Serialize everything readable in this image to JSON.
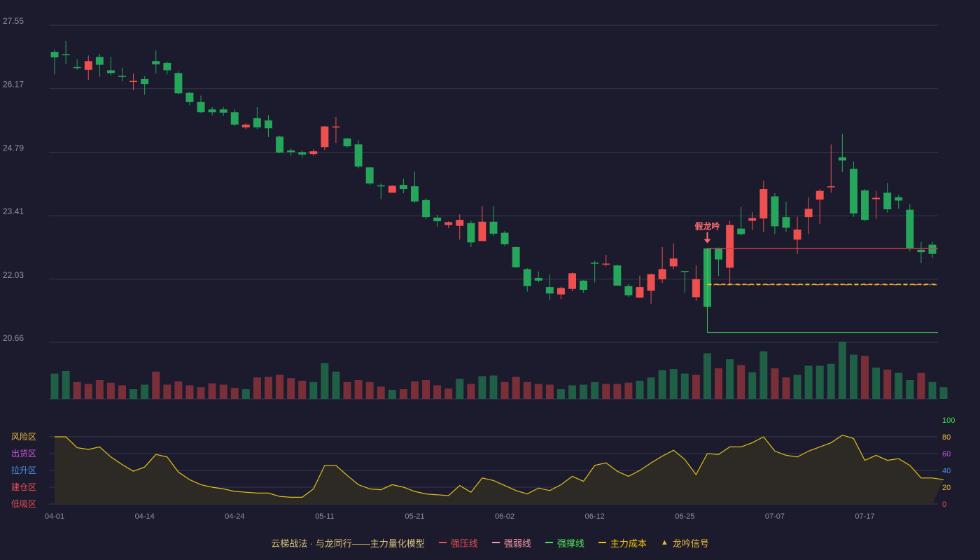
{
  "colors": {
    "background": "#1b1b2d",
    "up": "#ef4f4f",
    "down": "#26a65b",
    "up_volume": "#7a2f38",
    "down_volume": "#1f5f45",
    "strong_pressure": "#d03a45",
    "strong_weak": "#ff8fa0",
    "support": "#3ec74a",
    "main_cost": "#f5c400",
    "indicator_line": "#e2c215",
    "indicator_fill": "#2e2b25",
    "signal": "#ff6b6b",
    "grid": "#33374a",
    "axis_text": "#8a8f9e"
  },
  "legend": {
    "title": "云梯战法 · 与龙同行——主力量化模型",
    "items": [
      {
        "label": "强压线",
        "color": "#ef4f4f",
        "style": "solid"
      },
      {
        "label": "强弱线",
        "color": "#ff9aa8",
        "style": "dash"
      },
      {
        "label": "强撑线",
        "color": "#4fe35a",
        "style": "solid"
      },
      {
        "label": "主力成本",
        "color": "#f5c400",
        "style": "dash"
      },
      {
        "label": "龙吟信号",
        "color": "#f0b83a",
        "style": "triangle",
        "icon": "▲"
      }
    ]
  },
  "chart_data": {
    "type": "candlestick",
    "x_ticks": [
      "04-01",
      "04-14",
      "04-24",
      "05-11",
      "05-21",
      "06-02",
      "06-12",
      "06-25",
      "07-07",
      "07-17"
    ],
    "x_tick_index": [
      0,
      8,
      16,
      24,
      32,
      40,
      48,
      56,
      64,
      72
    ],
    "ylim": [
      20.66,
      27.55
    ],
    "y_ticks": [
      "27.55",
      "26.17",
      "24.79",
      "23.41",
      "22.03",
      "20.66"
    ],
    "candles": [
      [
        26.97,
        26.85,
        27.02,
        26.48
      ],
      [
        26.92,
        26.9,
        27.21,
        26.71
      ],
      [
        26.64,
        26.63,
        26.81,
        26.58
      ],
      [
        26.58,
        26.77,
        26.89,
        26.36
      ],
      [
        26.86,
        26.69,
        26.93,
        26.43
      ],
      [
        26.57,
        26.51,
        26.86,
        26.47
      ],
      [
        26.45,
        26.43,
        26.63,
        26.33
      ],
      [
        26.34,
        26.34,
        26.5,
        26.14
      ],
      [
        26.38,
        26.27,
        26.44,
        26.04
      ],
      [
        26.77,
        26.7,
        27.0,
        26.5
      ],
      [
        26.73,
        26.57,
        26.76,
        26.48
      ],
      [
        26.51,
        26.07,
        26.55,
        26.05
      ],
      [
        26.08,
        25.88,
        26.1,
        25.81
      ],
      [
        25.88,
        25.66,
        26.02,
        25.64
      ],
      [
        25.72,
        25.66,
        25.77,
        25.59
      ],
      [
        25.72,
        25.65,
        25.77,
        25.58
      ],
      [
        25.66,
        25.39,
        25.72,
        25.36
      ],
      [
        25.33,
        25.39,
        25.42,
        25.29
      ],
      [
        25.53,
        25.33,
        25.77,
        25.29
      ],
      [
        25.48,
        25.31,
        25.6,
        25.12
      ],
      [
        25.13,
        24.78,
        25.15,
        24.77
      ],
      [
        24.83,
        24.79,
        24.87,
        24.71
      ],
      [
        24.79,
        24.74,
        24.83,
        24.67
      ],
      [
        24.75,
        24.81,
        24.86,
        24.71
      ],
      [
        24.9,
        25.35,
        25.36,
        24.84
      ],
      [
        25.34,
        25.35,
        25.56,
        24.99
      ],
      [
        25.09,
        24.92,
        25.1,
        24.89
      ],
      [
        24.96,
        24.48,
        25.05,
        24.44
      ],
      [
        24.46,
        24.11,
        24.47,
        24.08
      ],
      [
        24.07,
        24.06,
        24.11,
        23.77
      ],
      [
        23.91,
        24.06,
        24.07,
        24.04
      ],
      [
        24.08,
        23.99,
        24.21,
        23.9
      ],
      [
        24.05,
        23.72,
        24.37,
        23.69
      ],
      [
        23.75,
        23.38,
        23.79,
        23.33
      ],
      [
        23.37,
        23.29,
        23.43,
        23.17
      ],
      [
        23.21,
        23.27,
        23.29,
        23.14
      ],
      [
        23.19,
        23.32,
        23.44,
        22.89
      ],
      [
        23.25,
        22.83,
        23.3,
        22.73
      ],
      [
        22.86,
        23.28,
        23.62,
        22.86
      ],
      [
        23.28,
        23.02,
        23.62,
        22.97
      ],
      [
        23.04,
        22.79,
        23.08,
        22.75
      ],
      [
        22.73,
        22.29,
        22.74,
        22.28
      ],
      [
        22.25,
        21.88,
        22.27,
        21.76
      ],
      [
        22.06,
        22.0,
        22.2,
        21.96
      ],
      [
        21.86,
        21.72,
        22.13,
        21.57
      ],
      [
        21.7,
        21.84,
        21.87,
        21.6
      ],
      [
        21.82,
        22.16,
        22.18,
        21.77
      ],
      [
        22.0,
        21.8,
        22.01,
        21.74
      ],
      [
        22.39,
        22.37,
        22.43,
        21.96
      ],
      [
        22.37,
        22.37,
        22.56,
        22.31
      ],
      [
        22.33,
        21.89,
        22.35,
        21.89
      ],
      [
        21.88,
        21.68,
        21.93,
        21.64
      ],
      [
        21.63,
        21.86,
        22.11,
        21.62
      ],
      [
        21.78,
        22.14,
        22.15,
        21.5
      ],
      [
        22.03,
        22.25,
        22.73,
        21.95
      ],
      [
        22.31,
        22.48,
        22.81,
        22.25
      ],
      [
        22.21,
        22.2,
        22.21,
        21.74
      ],
      [
        21.64,
        22.03,
        22.33,
        21.56
      ],
      [
        22.7,
        21.43,
        22.69,
        21.35
      ],
      [
        22.69,
        22.46,
        22.72,
        22.1
      ],
      [
        22.28,
        23.21,
        23.3,
        21.92
      ],
      [
        23.13,
        23.01,
        23.6,
        22.98
      ],
      [
        23.3,
        23.36,
        23.49,
        23.1
      ],
      [
        23.35,
        23.99,
        24.17,
        23.06
      ],
      [
        23.83,
        23.18,
        23.9,
        23.01
      ],
      [
        23.38,
        23.15,
        23.71,
        23.06
      ],
      [
        22.89,
        23.11,
        23.39,
        22.58
      ],
      [
        23.38,
        23.56,
        23.81,
        23.01
      ],
      [
        23.76,
        23.95,
        23.99,
        23.23
      ],
      [
        24.05,
        24.05,
        24.96,
        23.91
      ],
      [
        24.68,
        24.61,
        25.19,
        24.36
      ],
      [
        24.43,
        23.46,
        24.59,
        23.39
      ],
      [
        23.96,
        23.32,
        23.99,
        23.29
      ],
      [
        23.77,
        23.8,
        23.95,
        23.34
      ],
      [
        23.91,
        23.55,
        24.12,
        23.48
      ],
      [
        23.81,
        23.74,
        23.86,
        23.56
      ],
      [
        23.54,
        22.71,
        23.66,
        22.64
      ],
      [
        22.67,
        22.62,
        22.84,
        22.38
      ],
      [
        22.78,
        22.58,
        22.84,
        22.49
      ]
    ],
    "volume": [
      [
        39,
        0
      ],
      [
        43,
        0
      ],
      [
        26,
        1
      ],
      [
        23,
        1
      ],
      [
        29,
        1
      ],
      [
        25,
        1
      ],
      [
        21,
        1
      ],
      [
        15,
        0
      ],
      [
        22,
        0
      ],
      [
        42,
        1
      ],
      [
        22,
        1
      ],
      [
        27,
        1
      ],
      [
        21,
        1
      ],
      [
        18,
        1
      ],
      [
        24,
        1
      ],
      [
        22,
        1
      ],
      [
        17,
        1
      ],
      [
        15,
        0
      ],
      [
        33,
        1
      ],
      [
        34,
        1
      ],
      [
        37,
        1
      ],
      [
        32,
        1
      ],
      [
        28,
        1
      ],
      [
        26,
        0
      ],
      [
        55,
        0
      ],
      [
        42,
        0
      ],
      [
        26,
        1
      ],
      [
        29,
        1
      ],
      [
        26,
        1
      ],
      [
        19,
        1
      ],
      [
        14,
        0
      ],
      [
        15,
        1
      ],
      [
        27,
        1
      ],
      [
        29,
        1
      ],
      [
        21,
        1
      ],
      [
        16,
        1
      ],
      [
        31,
        0
      ],
      [
        23,
        1
      ],
      [
        35,
        0
      ],
      [
        36,
        0
      ],
      [
        26,
        1
      ],
      [
        34,
        1
      ],
      [
        26,
        1
      ],
      [
        23,
        1
      ],
      [
        22,
        1
      ],
      [
        15,
        0
      ],
      [
        21,
        0
      ],
      [
        22,
        0
      ],
      [
        26,
        0
      ],
      [
        23,
        1
      ],
      [
        23,
        1
      ],
      [
        25,
        1
      ],
      [
        28,
        0
      ],
      [
        33,
        0
      ],
      [
        44,
        0
      ],
      [
        46,
        0
      ],
      [
        39,
        0
      ],
      [
        37,
        1
      ],
      [
        70,
        0
      ],
      [
        47,
        1
      ],
      [
        61,
        0
      ],
      [
        52,
        1
      ],
      [
        41,
        0
      ],
      [
        73,
        0
      ],
      [
        47,
        1
      ],
      [
        33,
        1
      ],
      [
        37,
        0
      ],
      [
        51,
        0
      ],
      [
        51,
        0
      ],
      [
        54,
        0
      ],
      [
        88,
        0
      ],
      [
        68,
        0
      ],
      [
        66,
        1
      ],
      [
        48,
        0
      ],
      [
        45,
        1
      ],
      [
        40,
        0
      ],
      [
        29,
        0
      ],
      [
        40,
        1
      ],
      [
        26,
        0
      ],
      [
        18,
        0
      ]
    ],
    "indicator": {
      "ylim": [
        0,
        100
      ],
      "right_ticks": [
        {
          "v": 100,
          "label": "100",
          "color": "#3ee24a"
        },
        {
          "v": 80,
          "label": "80",
          "color": "#f0b83a"
        },
        {
          "v": 60,
          "label": "60",
          "color": "#d24fe0"
        },
        {
          "v": 40,
          "label": "40",
          "color": "#4b8fe9"
        },
        {
          "v": 20,
          "label": "20",
          "color": "#f0b83a"
        },
        {
          "v": 0,
          "label": "0",
          "color": "#ef4f4f"
        }
      ],
      "zones": [
        {
          "label": "风险区",
          "v": 80,
          "color": "#f0b83a"
        },
        {
          "label": "出货区",
          "v": 60,
          "color": "#d24fe0"
        },
        {
          "label": "拉升区",
          "v": 40,
          "color": "#4b8fe9"
        },
        {
          "label": "建仓区",
          "v": 20,
          "color": "#ef4f4f"
        },
        {
          "label": "低吸区",
          "v": 0,
          "color": "#ef4f4f"
        }
      ],
      "values": [
        80,
        80,
        67,
        65,
        68,
        56,
        47,
        39,
        44,
        59,
        56,
        38,
        29,
        23,
        20,
        18,
        15,
        14,
        13,
        13,
        9,
        8,
        8,
        18,
        46,
        46,
        34,
        23,
        18,
        17,
        23,
        20,
        15,
        12,
        11,
        10,
        22,
        14,
        31,
        28,
        22,
        16,
        12,
        19,
        16,
        23,
        33,
        27,
        46,
        49,
        39,
        33,
        40,
        49,
        57,
        64,
        53,
        35,
        60,
        59,
        68,
        68,
        73,
        80,
        63,
        58,
        56,
        63,
        68,
        73,
        82,
        78,
        52,
        58,
        52,
        54,
        46,
        31,
        31,
        29
      ]
    },
    "lines": {
      "strong_pressure": {
        "value": 22.7,
        "from_index": 58
      },
      "strong_weak": {
        "value": 21.91,
        "from_index": 58
      },
      "main_cost": {
        "value": 21.92,
        "from_index": 58
      },
      "support": {
        "value": 20.87,
        "from_index": 58
      }
    },
    "signal": {
      "label": "假龙吟",
      "index": 58
    }
  }
}
